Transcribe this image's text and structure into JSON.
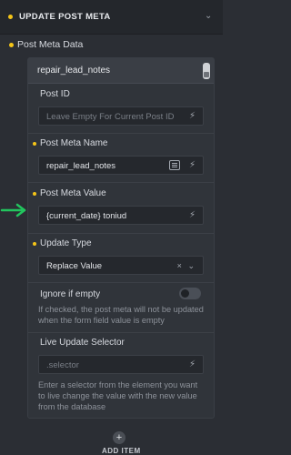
{
  "header": {
    "title": "UPDATE POST META",
    "chevron_icon": "chevron-down-icon"
  },
  "section": {
    "label": "Post Meta Data"
  },
  "group": {
    "title": "repair_lead_notes",
    "fields": {
      "post_id": {
        "label": "Post ID",
        "placeholder": "Leave Empty For Current Post ID"
      },
      "post_meta_name": {
        "label": "Post Meta Name",
        "value": "repair_lead_notes"
      },
      "post_meta_value": {
        "label": "Post Meta Value",
        "value": "{current_date} toniud"
      },
      "update_type": {
        "label": "Update Type",
        "value": "Replace Value",
        "clear": "×",
        "chevron": "⌄"
      },
      "ignore_if_empty": {
        "label": "Ignore if empty",
        "help": "If checked, the post meta will not be updated when the form field value is empty",
        "checked": false
      },
      "live_update_selector": {
        "label": "Live Update Selector",
        "placeholder": ".selector",
        "help": "Enter a selector from the element you want to live change the value with the new value from the database"
      }
    }
  },
  "footer": {
    "add_label": "ADD ITEM",
    "add_symbol": "+"
  },
  "colors": {
    "accent": "#f5c518",
    "annotation_arrow": "#22c55e",
    "background": "#2b2e34"
  }
}
